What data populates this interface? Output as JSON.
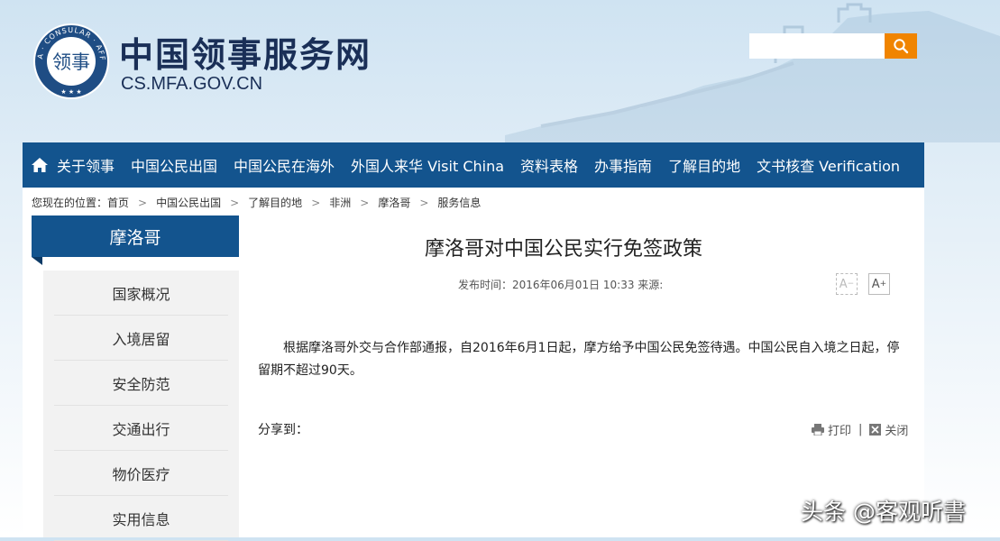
{
  "header": {
    "logo_text": "CHINA · CONSULAR · AFFAIRS",
    "logo_glyph": "领事",
    "site_title": "中国领事服务网",
    "site_url": "CS.MFA.GOV.CN",
    "search": {
      "value": "",
      "placeholder": ""
    }
  },
  "nav": {
    "home_icon": "home-icon",
    "items": [
      "关于领事",
      "中国公民出国",
      "中国公民在海外",
      "外国人来华 Visit China",
      "资料表格",
      "办事指南",
      "了解目的地",
      "文书核查 Verification"
    ]
  },
  "breadcrumb": {
    "prefix": "您现在的位置：",
    "items": [
      "首页",
      "中国公民出国",
      "了解目的地",
      "非洲",
      "摩洛哥",
      "服务信息"
    ]
  },
  "sidebar": {
    "title": "摩洛哥",
    "items": [
      "国家概况",
      "入境居留",
      "安全防范",
      "交通出行",
      "物价医疗",
      "实用信息"
    ]
  },
  "article": {
    "title": "摩洛哥对中国公民实行免签政策",
    "meta": "发布时间：2016年06月01日 10:33 来源:",
    "font_smaller": "A",
    "font_larger": "A",
    "body": "根据摩洛哥外交与合作部通报，自2016年6月1日起，摩方给予中国公民免签待遇。中国公民自入境之日起，停留期不超过90天。",
    "share_label": "分享到：",
    "print_label": "打印",
    "divider": "|",
    "close_label": "关闭"
  },
  "watermark": "头条 @客观听書",
  "colors": {
    "nav_bg": "#13548e",
    "search_btn": "#f08400",
    "title_text": "#1a2f57",
    "sidebar_bg": "#f2f2f2"
  }
}
